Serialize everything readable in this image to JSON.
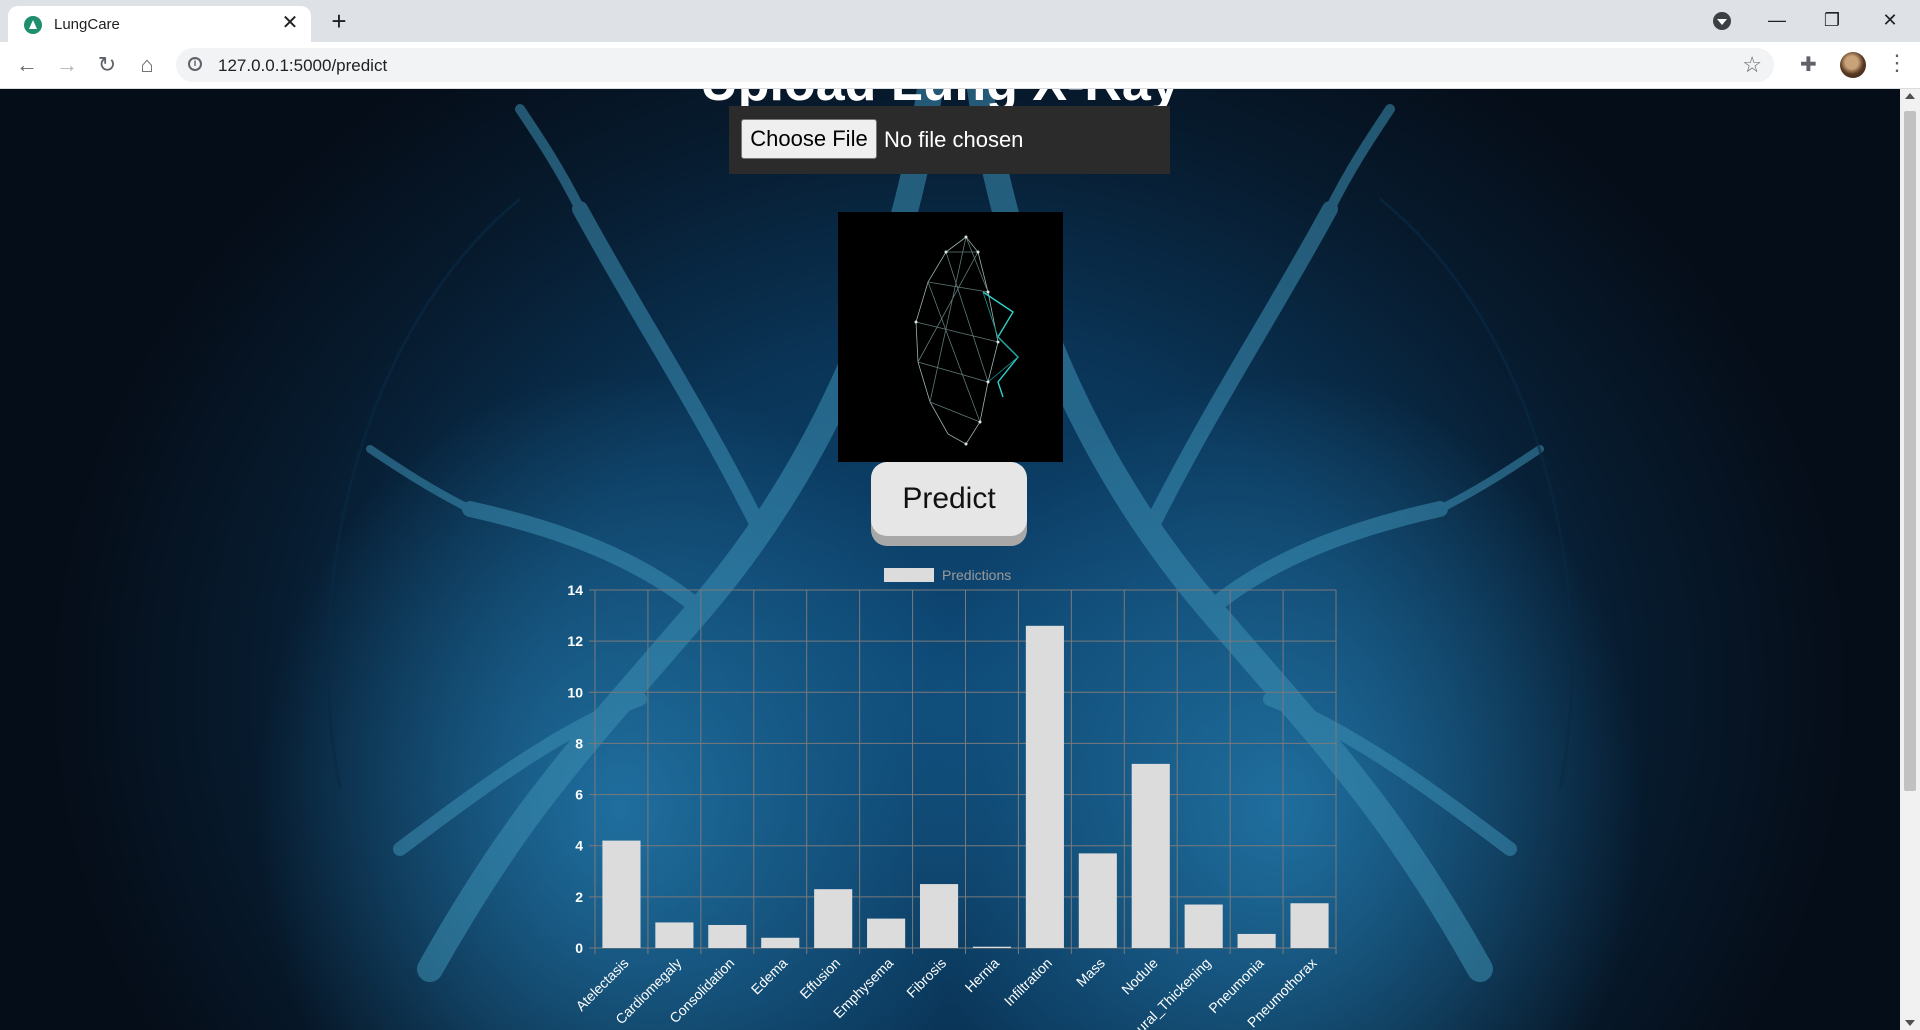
{
  "browser": {
    "tab_title": "LungCare",
    "url": "127.0.0.1:5000/predict"
  },
  "page": {
    "heading": "Upload Lung X-Ray",
    "choose_file_label": "Choose File",
    "file_status": "No file chosen",
    "predict_label": "Predict"
  },
  "colors": {
    "bar_fill": "#dcdcdc",
    "grid": "#7a7a7a",
    "legend_text": "#9a9a9a"
  },
  "chart_data": {
    "type": "bar",
    "legend": "Predictions",
    "categories": [
      "Atelectasis",
      "Cardiomegaly",
      "Consolidation",
      "Edema",
      "Effusion",
      "Emphysema",
      "Fibrosis",
      "Hernia",
      "Infiltration",
      "Mass",
      "Nodule",
      "Pleural_Thickening",
      "Pneumonia",
      "Pneumothorax"
    ],
    "series": [
      {
        "name": "Predictions",
        "values": [
          4.2,
          1.0,
          0.9,
          0.4,
          2.3,
          1.15,
          2.5,
          0.05,
          12.6,
          3.7,
          7.2,
          1.7,
          0.55,
          1.75
        ]
      }
    ],
    "ylim": [
      0,
      14
    ],
    "yticks": [
      0,
      2,
      4,
      6,
      8,
      10,
      12,
      14
    ],
    "grid": true,
    "legend_position": "top"
  }
}
